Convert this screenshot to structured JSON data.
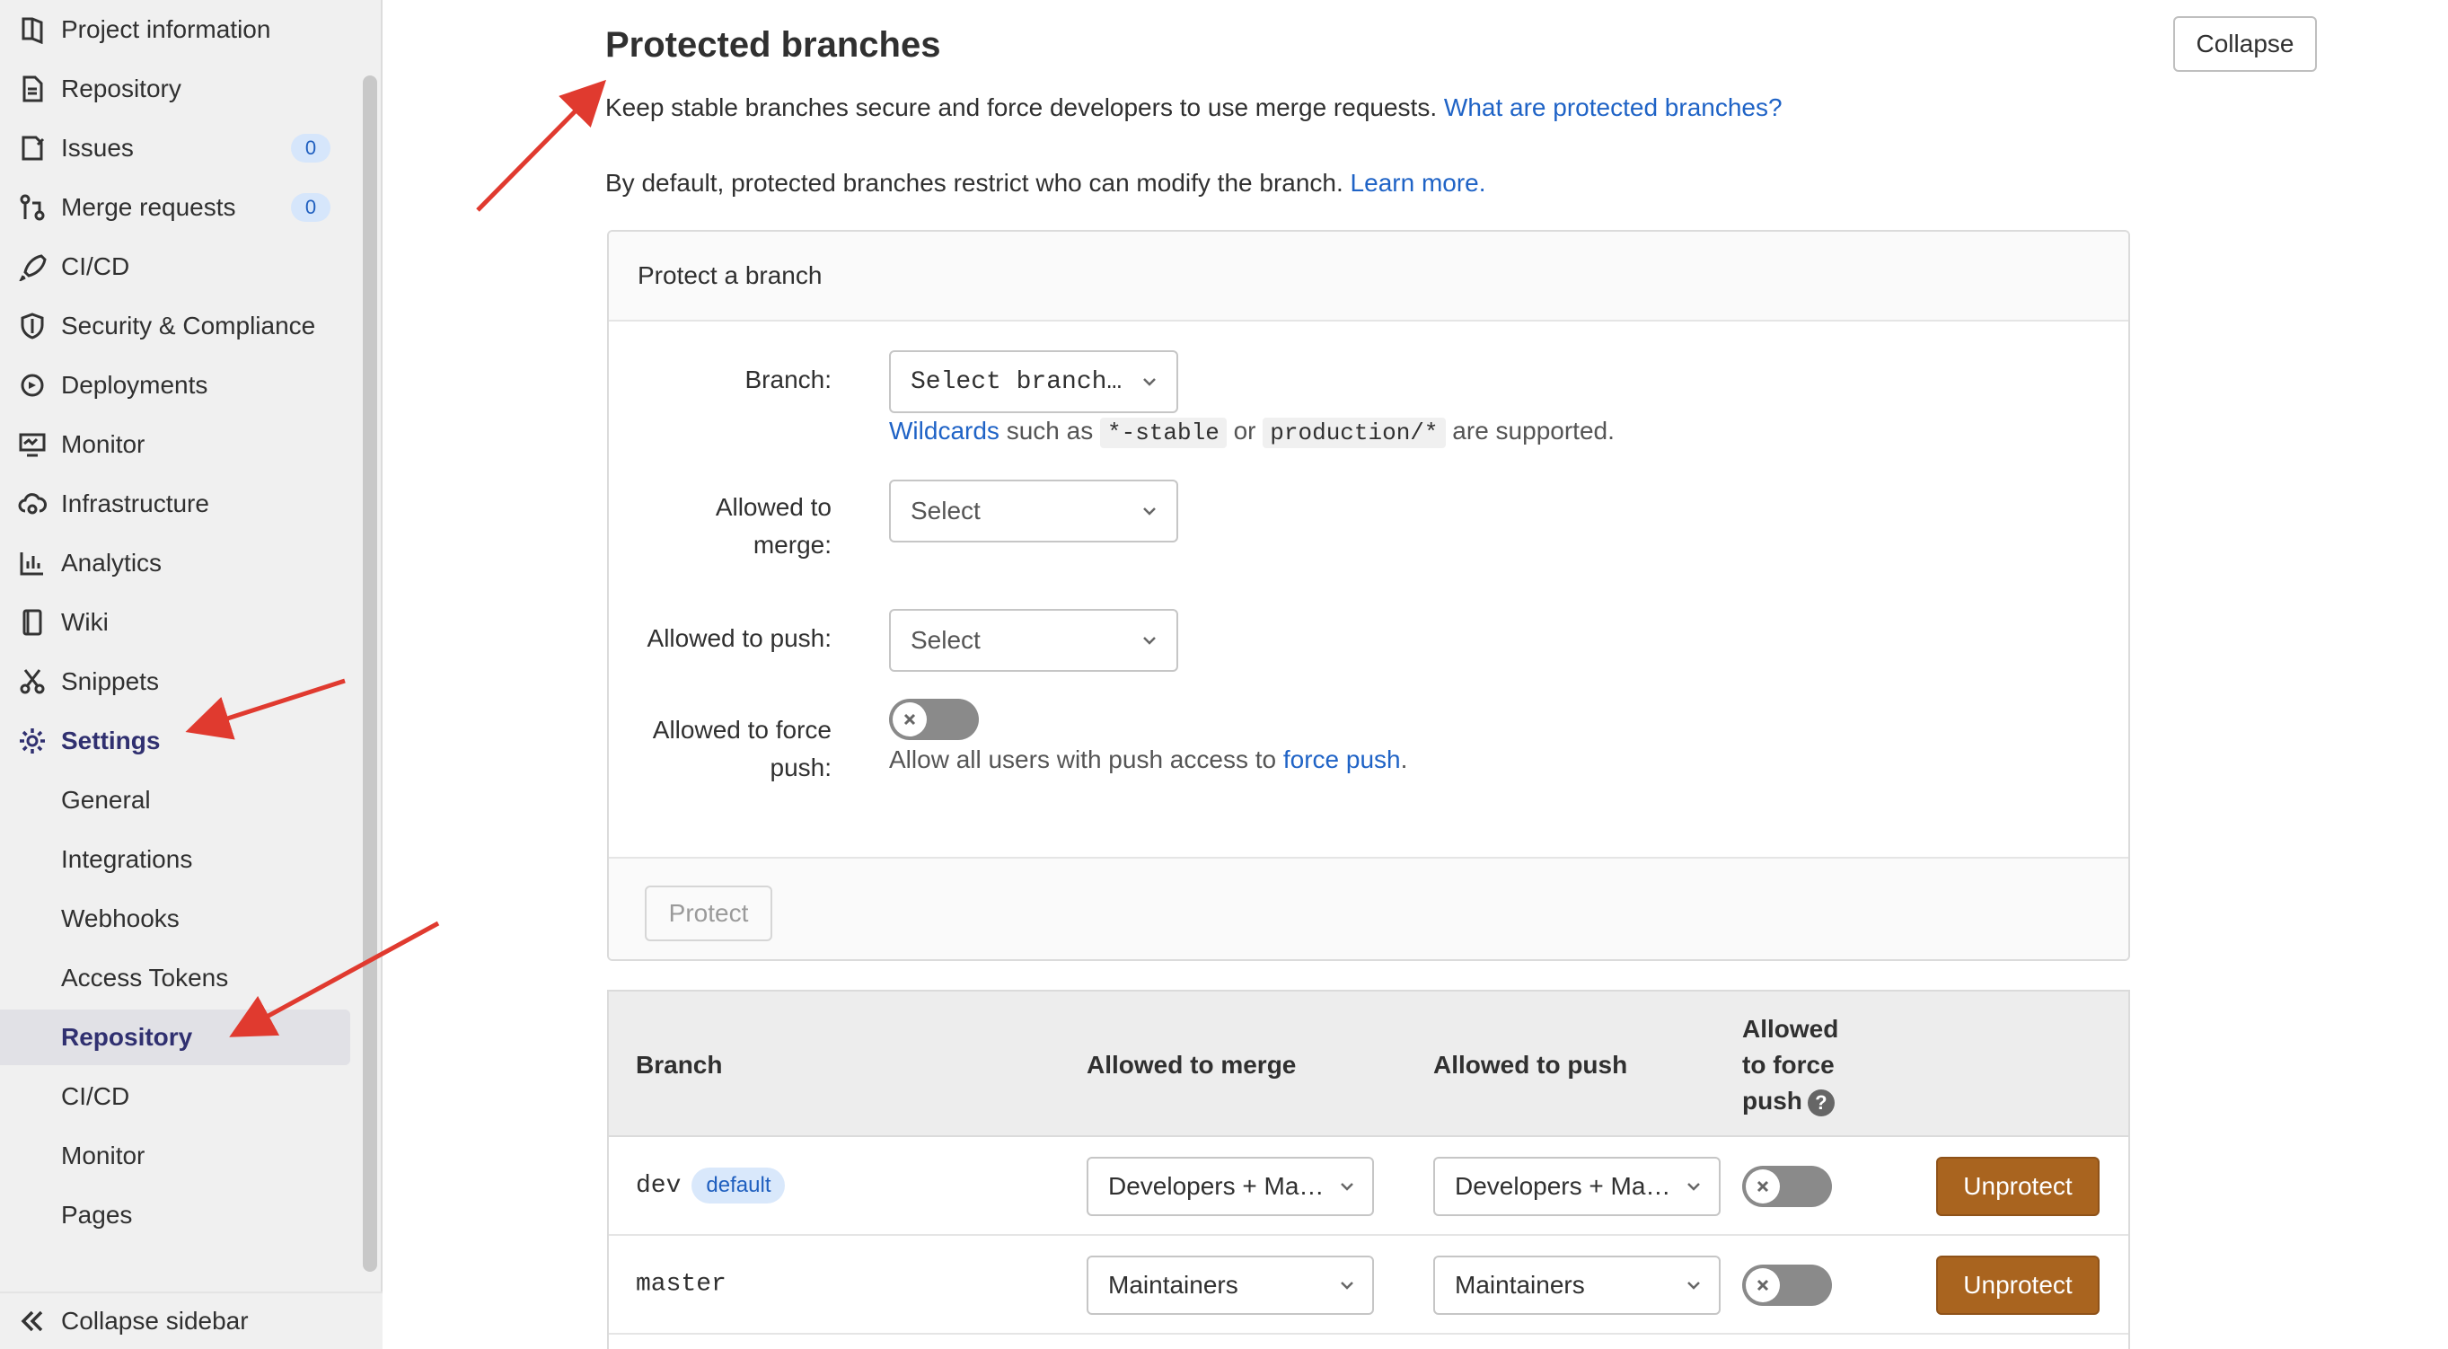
{
  "sidebar": {
    "items": [
      {
        "label": "Project information",
        "icon": "project-icon"
      },
      {
        "label": "Repository",
        "icon": "document-icon"
      },
      {
        "label": "Issues",
        "icon": "issues-icon",
        "badge": "0"
      },
      {
        "label": "Merge requests",
        "icon": "merge-request-icon",
        "badge": "0"
      },
      {
        "label": "CI/CD",
        "icon": "rocket-icon"
      },
      {
        "label": "Security & Compliance",
        "icon": "shield-icon"
      },
      {
        "label": "Deployments",
        "icon": "deployments-icon"
      },
      {
        "label": "Monitor",
        "icon": "monitor-icon"
      },
      {
        "label": "Infrastructure",
        "icon": "cloud-gear-icon"
      },
      {
        "label": "Analytics",
        "icon": "chart-icon"
      },
      {
        "label": "Wiki",
        "icon": "book-icon"
      },
      {
        "label": "Snippets",
        "icon": "scissors-icon"
      },
      {
        "label": "Settings",
        "icon": "gear-icon"
      }
    ],
    "settings_subitems": [
      "General",
      "Integrations",
      "Webhooks",
      "Access Tokens",
      "Repository",
      "CI/CD",
      "Monitor",
      "Pages"
    ],
    "active_subitem": "Repository",
    "collapse_label": "Collapse sidebar"
  },
  "section": {
    "title": "Protected branches",
    "collapse_label": "Collapse",
    "desc1": "Keep stable branches secure and force developers to use merge requests.",
    "desc1_link": "What are protected branches?",
    "desc2": "By default, protected branches restrict who can modify the branch.",
    "desc2_link": "Learn more."
  },
  "protect_form": {
    "header": "Protect a branch",
    "branch_label": "Branch:",
    "branch_value": "Select branch…",
    "wildcards_link": "Wildcards",
    "wildcards_text1": "such as",
    "wildcard_example1": "*-stable",
    "wildcards_or": "or",
    "wildcard_example2": "production/*",
    "wildcards_text2": "are supported.",
    "merge_label_line1": "Allowed to",
    "merge_label_line2": "merge:",
    "merge_value": "Select",
    "push_label": "Allowed to push:",
    "push_value": "Select",
    "force_label_line1": "Allowed to force",
    "force_label_line2": "push:",
    "force_help": "Allow all users with push access to",
    "force_help_link": "force push",
    "force_help_end": ".",
    "protect_button": "Protect"
  },
  "table": {
    "headers": {
      "branch": "Branch",
      "merge": "Allowed to merge",
      "push": "Allowed to push",
      "force_line1": "Allowed",
      "force_line2": "to force",
      "force_line3": "push"
    },
    "rows": [
      {
        "branch": "dev",
        "tag": "default",
        "merge": "Developers + Ma…",
        "push": "Developers + Ma…",
        "action": "Unprotect"
      },
      {
        "branch": "master",
        "merge": "Maintainers",
        "push": "Maintainers",
        "action": "Unprotect"
      }
    ]
  },
  "colors": {
    "accent_link": "#1f63c6",
    "unprotect_button": "#a9641f",
    "annotation_arrow": "#e03a2f",
    "active_nav_text": "#303070"
  }
}
